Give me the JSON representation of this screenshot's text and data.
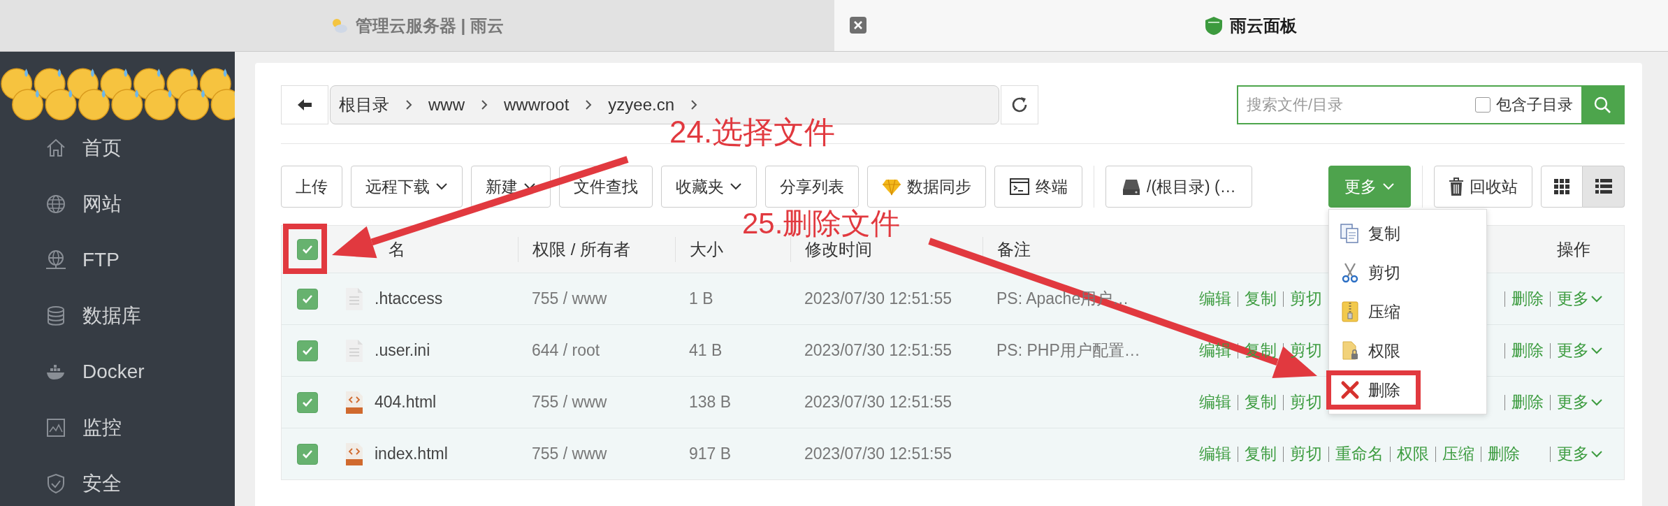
{
  "browser_tabs": [
    {
      "title": "管理云服务器 | 雨云",
      "selected": false
    },
    {
      "title": "雨云面板",
      "selected": true
    }
  ],
  "sidebar": {
    "items": [
      {
        "label": "首页"
      },
      {
        "label": "网站"
      },
      {
        "label": "FTP"
      },
      {
        "label": "数据库"
      },
      {
        "label": "Docker"
      },
      {
        "label": "监控"
      },
      {
        "label": "安全"
      }
    ]
  },
  "breadcrumb": [
    "根目录",
    "www",
    "wwwroot",
    "yzyee.cn"
  ],
  "search": {
    "placeholder": "搜索文件/目录",
    "subdir_label": "包含子目录",
    "subdir_checked": false
  },
  "toolbar": [
    {
      "label": "上传",
      "kind": "plain"
    },
    {
      "label": "远程下载",
      "kind": "dropdown"
    },
    {
      "label": "新建",
      "kind": "dropdown"
    },
    {
      "label": "文件查找",
      "kind": "plain"
    },
    {
      "label": "收藏夹",
      "kind": "dropdown"
    },
    {
      "label": "分享列表",
      "kind": "plain"
    },
    {
      "label": "数据同步",
      "kind": "sync"
    },
    {
      "label": "终端",
      "kind": "terminal"
    },
    {
      "label": "/(根目录) (…",
      "kind": "disk"
    }
  ],
  "more_button": "更多",
  "recycle_button": "回收站",
  "view_modes": [
    {
      "kind": "grid",
      "selected": false
    },
    {
      "kind": "list",
      "selected": true
    }
  ],
  "more_menu": [
    {
      "label": "复制",
      "kind": "copy",
      "highlighted": false
    },
    {
      "label": "剪切",
      "kind": "cut",
      "highlighted": false
    },
    {
      "label": "压缩",
      "kind": "zip",
      "highlighted": false
    },
    {
      "label": "权限",
      "kind": "lock",
      "highlighted": false
    },
    {
      "label": "删除",
      "kind": "delete",
      "highlighted": true
    }
  ],
  "table": {
    "select_all": true,
    "select_all_highlighted": true,
    "columns": [
      "名",
      "权限 / 所有者",
      "大小",
      "修改时间",
      "备注",
      "操作"
    ],
    "rows": [
      {
        "checked": true,
        "kind": "text",
        "name": ".htaccess",
        "perm": "755 / www",
        "size": "1 B",
        "mtime": "2023/07/30 12:51:55",
        "note": "PS: Apache用户…",
        "actions": [
          "编辑",
          "复制",
          "剪切"
        ],
        "actions_end": [
          "删除"
        ],
        "more": "更多"
      },
      {
        "checked": true,
        "kind": "text",
        "name": ".user.ini",
        "perm": "644 / root",
        "size": "41 B",
        "mtime": "2023/07/30 12:51:55",
        "note": "PS: PHP用户配置…",
        "actions": [
          "编辑",
          "复制",
          "剪切"
        ],
        "actions_end": [
          "删除"
        ],
        "more": "更多"
      },
      {
        "checked": true,
        "kind": "html",
        "name": "404.html",
        "perm": "755 / www",
        "size": "138 B",
        "mtime": "2023/07/30 12:51:55",
        "actions": [
          "编辑",
          "复制",
          "剪切"
        ],
        "actions_end": [
          "删除"
        ],
        "more": "更多"
      },
      {
        "checked": true,
        "kind": "html",
        "name": "index.html",
        "perm": "755 / www",
        "size": "917 B",
        "mtime": "2023/07/30 12:51:55",
        "actions": [
          "编辑",
          "复制",
          "剪切",
          "重命名",
          "权限",
          "压缩",
          "删除"
        ],
        "more": "更多"
      }
    ]
  },
  "annotations": [
    {
      "label": "24.选择文件"
    },
    {
      "label": "25.删除文件"
    }
  ]
}
